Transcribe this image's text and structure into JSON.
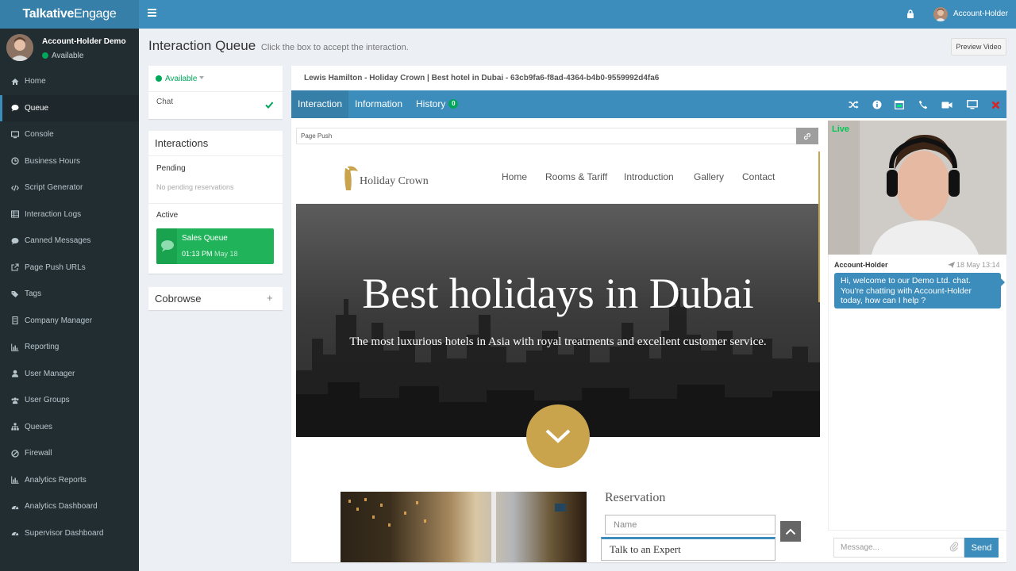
{
  "app": {
    "logo_bold": "Talkative",
    "logo_light": "Engage"
  },
  "topbar": {
    "user": "Account-Holder"
  },
  "sidebar": {
    "user_name": "Account-Holder Demo",
    "status": "Available",
    "items": [
      {
        "label": "Home",
        "icon": "home-icon"
      },
      {
        "label": "Queue",
        "icon": "chat-bubble-icon"
      },
      {
        "label": "Console",
        "icon": "monitor-icon"
      },
      {
        "label": "Business Hours",
        "icon": "clock-icon"
      },
      {
        "label": "Script Generator",
        "icon": "code-icon"
      },
      {
        "label": "Interaction Logs",
        "icon": "table-icon"
      },
      {
        "label": "Canned Messages",
        "icon": "chat-bubble-icon"
      },
      {
        "label": "Page Push URLs",
        "icon": "external-link-icon"
      },
      {
        "label": "Tags",
        "icon": "tags-icon"
      },
      {
        "label": "Company Manager",
        "icon": "building-icon"
      },
      {
        "label": "Reporting",
        "icon": "bar-chart-icon"
      },
      {
        "label": "User Manager",
        "icon": "user-icon"
      },
      {
        "label": "User Groups",
        "icon": "users-icon"
      },
      {
        "label": "Queues",
        "icon": "sitemap-icon"
      },
      {
        "label": "Firewall",
        "icon": "ban-icon"
      },
      {
        "label": "Analytics Reports",
        "icon": "bar-chart-icon"
      },
      {
        "label": "Analytics Dashboard",
        "icon": "dashboard-icon"
      },
      {
        "label": "Supervisor Dashboard",
        "icon": "dashboard-icon"
      }
    ]
  },
  "header": {
    "title": "Interaction Queue",
    "subtitle": "Click the box to accept the interaction.",
    "preview_button": "Preview Video"
  },
  "status_box": {
    "status": "Available",
    "channel": "Chat"
  },
  "interactions": {
    "title": "Interactions",
    "pending_label": "Pending",
    "pending_empty": "No pending reservations",
    "active_label": "Active",
    "card": {
      "queue": "Sales Queue",
      "time": "01:13 PM",
      "date": "May 18"
    }
  },
  "cobrowse": {
    "title": "Cobrowse",
    "plus": "+"
  },
  "main": {
    "title": "Lewis Hamilton - Holiday Crown | Best hotel in Dubai - 63cb9fa6-f8ad-4364-b4b0-9559992d4fa6",
    "tabs": [
      {
        "label": "Interaction"
      },
      {
        "label": "Information"
      },
      {
        "label": "History",
        "badge": "0"
      }
    ],
    "page_push_label": "Page Push"
  },
  "site": {
    "brand": "Holiday Crown",
    "nav": [
      "Home",
      "Rooms & Tariff",
      "Introduction",
      "Gallery",
      "Contact"
    ],
    "hero_title": "Best holidays in Dubai",
    "hero_sub": "The most luxurious hotels in Asia with royal treatments and excellent customer service.",
    "reservation_title": "Reservation",
    "name_placeholder": "Name",
    "expert_label": "Talk to an Expert"
  },
  "video": {
    "live_label": "Live"
  },
  "chat": {
    "sender": "Account-Holder",
    "timestamp": "18 May 13:14",
    "message": "Hi, welcome to our Demo Ltd. chat. You're chatting with Account-Holder today, how can I help ?",
    "input_placeholder": "Message...",
    "send_label": "Send"
  },
  "colors": {
    "brand_blue": "#3c8dbc",
    "sidebar_bg": "#222d32",
    "success_green": "#00a65a",
    "gold": "#c9a44d"
  }
}
